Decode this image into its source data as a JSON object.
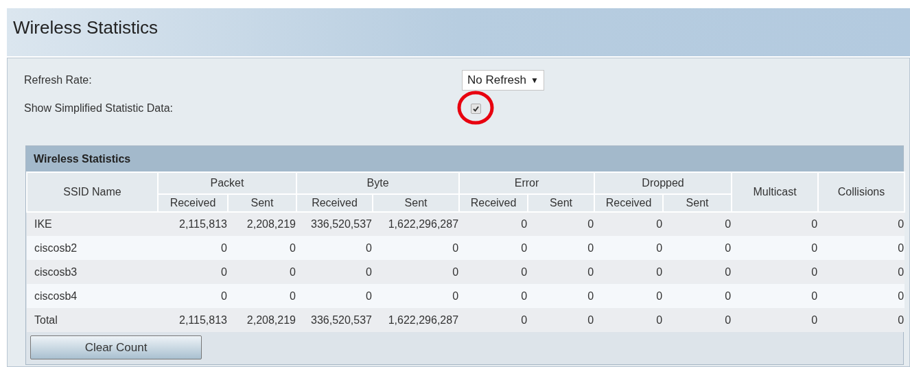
{
  "page_title": "Wireless Statistics",
  "settings": {
    "refresh_rate": {
      "label": "Refresh Rate:",
      "value": "No Refresh",
      "arrow": "▼"
    },
    "simplified": {
      "label": "Show Simplified Statistic Data:",
      "checked": true,
      "highlighted": true
    }
  },
  "table": {
    "title": "Wireless Statistics",
    "header_rows": [
      [
        {
          "label": "SSID Name",
          "rowspan": 2
        },
        {
          "label": "Packet",
          "colspan": 2
        },
        {
          "label": "Byte",
          "colspan": 2
        },
        {
          "label": "Error",
          "colspan": 2
        },
        {
          "label": "Dropped",
          "colspan": 2
        },
        {
          "label": "Multicast",
          "rowspan": 2
        },
        {
          "label": "Collisions",
          "rowspan": 2
        }
      ],
      [
        {
          "label": "Received"
        },
        {
          "label": "Sent"
        },
        {
          "label": "Received"
        },
        {
          "label": "Sent"
        },
        {
          "label": "Received"
        },
        {
          "label": "Sent"
        },
        {
          "label": "Received"
        },
        {
          "label": "Sent"
        }
      ]
    ],
    "rows": [
      {
        "cells": [
          "IKE",
          "2,115,813",
          "2,208,219",
          "336,520,537",
          "1,622,296,287",
          "0",
          "0",
          "0",
          "0",
          "0",
          "0"
        ]
      },
      {
        "cells": [
          "ciscosb2",
          "0",
          "0",
          "0",
          "0",
          "0",
          "0",
          "0",
          "0",
          "0",
          "0"
        ]
      },
      {
        "cells": [
          "ciscosb3",
          "0",
          "0",
          "0",
          "0",
          "0",
          "0",
          "0",
          "0",
          "0",
          "0"
        ]
      },
      {
        "cells": [
          "ciscosb4",
          "0",
          "0",
          "0",
          "0",
          "0",
          "0",
          "0",
          "0",
          "0",
          "0"
        ]
      },
      {
        "cells": [
          "Total",
          "2,115,813",
          "2,208,219",
          "336,520,537",
          "1,622,296,287",
          "0",
          "0",
          "0",
          "0",
          "0",
          "0"
        ]
      }
    ]
  },
  "buttons": [
    {
      "label": "Clear Count"
    }
  ]
}
